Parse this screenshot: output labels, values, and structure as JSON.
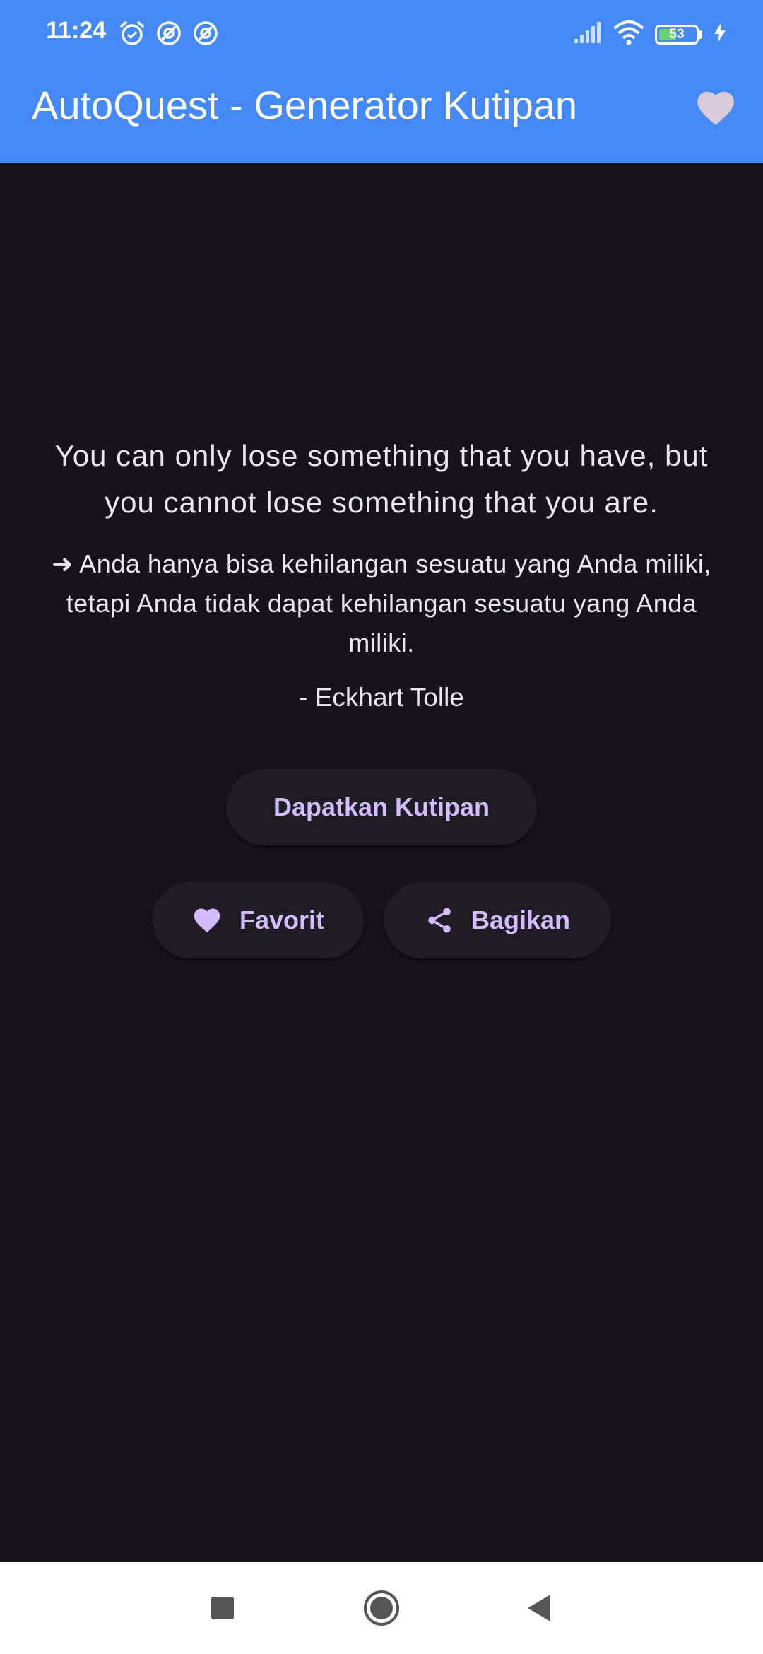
{
  "status_bar": {
    "time": "11:24",
    "battery_level": "53",
    "battery_fraction": 0.53,
    "left_icons": [
      "alarm-icon",
      "data-saver-icon",
      "data-saver-icon"
    ],
    "right_icons": [
      "signal-icon",
      "wifi-icon",
      "battery-icon",
      "charging-icon"
    ]
  },
  "app_bar": {
    "title": "AutoQuest - Generator Kutipan",
    "action_icon": "heart-icon"
  },
  "quote": {
    "english": "You can only lose something that you have, but you cannot lose something that you are.",
    "translation": "➜ Anda hanya bisa kehilangan sesuatu yang Anda miliki, tetapi Anda tidak dapat kehilangan sesuatu yang Anda miliki.",
    "author": "- Eckhart Tolle"
  },
  "buttons": {
    "get_quote": "Dapatkan Kutipan",
    "favorite": "Favorit",
    "share": "Bagikan"
  },
  "nav_bar": {
    "items": [
      "recents-button",
      "home-button",
      "back-button"
    ]
  },
  "colors": {
    "app_bar": "#4589f7",
    "background": "#16141a",
    "button_bg": "#1f1d23",
    "accent": "#d3bcfd",
    "text": "#ece6f0",
    "app_bar_heart": "#d9cbd9"
  }
}
